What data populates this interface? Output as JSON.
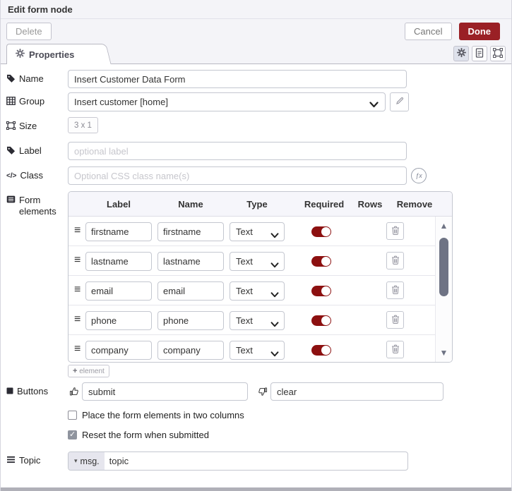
{
  "dialog": {
    "title": "Edit form node"
  },
  "toolbar": {
    "delete_label": "Delete",
    "cancel_label": "Cancel",
    "done_label": "Done"
  },
  "tabs": {
    "properties_label": "Properties"
  },
  "fields": {
    "name": {
      "label": "Name",
      "value": "Insert Customer Data Form"
    },
    "group": {
      "label": "Group",
      "value": "Insert customer [home]"
    },
    "size": {
      "label": "Size",
      "value": "3 x 1"
    },
    "label": {
      "label": "Label",
      "placeholder": "optional label"
    },
    "class": {
      "label": "Class",
      "placeholder": "Optional CSS class name(s)"
    },
    "form_elements": {
      "label": "Form elements"
    },
    "buttons": {
      "label": "Buttons",
      "submit_value": "submit",
      "clear_value": "clear"
    },
    "topic": {
      "label": "Topic",
      "prefix": "msg.",
      "value": "topic"
    }
  },
  "elements_table": {
    "headers": [
      "Label",
      "Name",
      "Type",
      "Required",
      "Rows",
      "Remove"
    ],
    "rows": [
      {
        "label": "firstname",
        "name": "firstname",
        "type": "Text",
        "required": true
      },
      {
        "label": "lastname",
        "name": "lastname",
        "type": "Text",
        "required": true
      },
      {
        "label": "email",
        "name": "email",
        "type": "Text",
        "required": true
      },
      {
        "label": "phone",
        "name": "phone",
        "type": "Text",
        "required": true
      },
      {
        "label": "company",
        "name": "company",
        "type": "Text",
        "required": true
      }
    ],
    "add_button": {
      "plus": "+",
      "label": "element"
    }
  },
  "options": [
    {
      "label": "Place the form elements in two columns",
      "checked": false
    },
    {
      "label": "Reset the form when submitted",
      "checked": true
    }
  ],
  "icons": {
    "drag_handle": "≡",
    "caret_down": "▾",
    "arrow_up": "▲",
    "arrow_down": "▼",
    "fx": "ƒx",
    "code": "</>"
  },
  "colors": {
    "accent_red": "#9a2025",
    "toggle_on": "#8c1010",
    "header_bg": "#f4f4f8",
    "table_header_bg": "#f6f6fb",
    "scrollbar": "#6e7384"
  }
}
